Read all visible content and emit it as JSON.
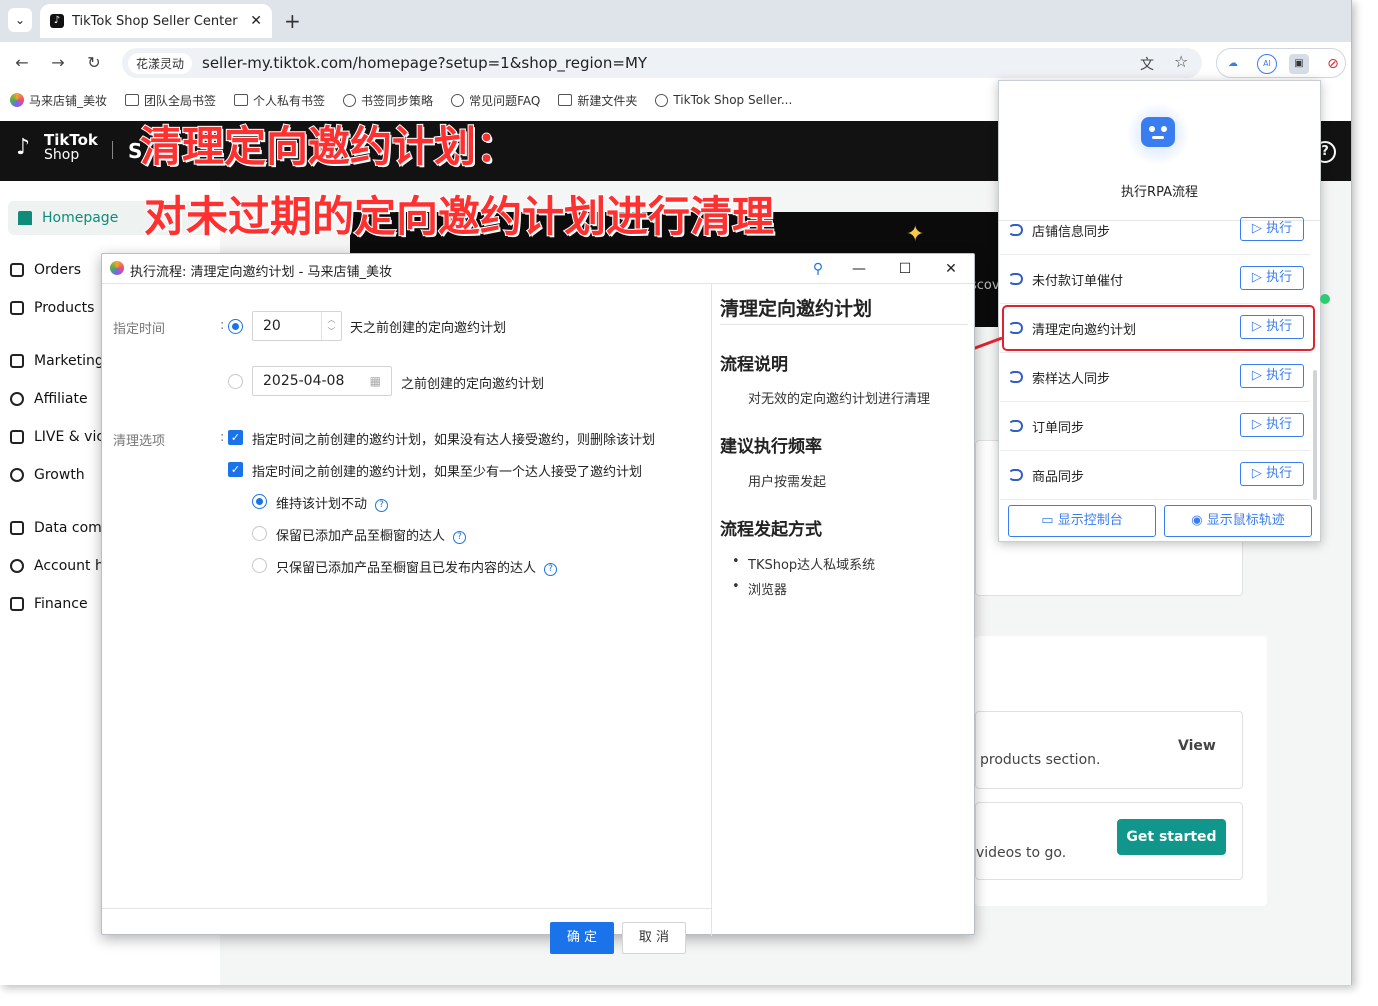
{
  "browser": {
    "tab_title": "TikTok Shop Seller Center | M",
    "site_chip": "花漾灵动",
    "url": "seller-my.tiktok.com/homepage?setup=1&shop_region=MY",
    "bookmarks": [
      "马来店铺_美妆",
      "团队全局书签",
      "个人私有书签",
      "书签同步策略",
      "常见问题FAQ",
      "新建文件夹",
      "TikTok Shop Seller..."
    ]
  },
  "tiktok": {
    "logo_top": "TikTok",
    "logo_bottom": "Shop",
    "header_text": "S",
    "sidebar": [
      "Homepage",
      "Orders",
      "Products",
      "Marketing",
      "Affiliate",
      "LIVE & vic",
      "Growth",
      "Data com",
      "Account h",
      "Finance"
    ],
    "banner_text": "scov",
    "card_view_text": "products section.",
    "card_view_link": "View",
    "card_get_text": "videos to go.",
    "get_started": "Get started"
  },
  "overlay": {
    "line1": "清理定向邀约计划：",
    "line2": "对未过期的定向邀约计划进行清理"
  },
  "rpa": {
    "title": "执行RPA流程",
    "rows": [
      {
        "label": "店铺信息同步",
        "button": "执行"
      },
      {
        "label": "未付款订单催付",
        "button": "执行"
      },
      {
        "label": "清理定向邀约计划",
        "button": "执行"
      },
      {
        "label": "索样达人同步",
        "button": "执行"
      },
      {
        "label": "订单同步",
        "button": "执行"
      },
      {
        "label": "商品同步",
        "button": "执行"
      }
    ],
    "footer_console": "显示控制台",
    "footer_mouse": "显示鼠标轨迹"
  },
  "dialog": {
    "title": "执行流程: 清理定向邀约计划 - 马来店铺_美妆",
    "time_label": "指定时间",
    "days_value": "20",
    "days_suffix": "天之前创建的定向邀约计划",
    "date_value": "2025-04-08",
    "date_suffix": "之前创建的定向邀约计划",
    "cleanup_label": "清理选项",
    "opt1": "指定时间之前创建的邀约计划，如果没有达人接受邀约，则删除该计划",
    "opt2": "指定时间之前创建的邀约计划，如果至少有一个达人接受了邀约计划",
    "sub1": "维持该计划不动",
    "sub2": "保留已添加产品至橱窗的达人",
    "sub3": "只保留已添加产品至橱窗且已发布内容的达人",
    "ok": "确 定",
    "cancel": "取 消",
    "doc_title": "清理定向邀约计划",
    "doc_h1": "流程说明",
    "doc_p1": "对无效的定向邀约计划进行清理",
    "doc_h2": "建议执行频率",
    "doc_p2": "用户按需发起",
    "doc_h3": "流程发起方式",
    "doc_li": [
      "TKShop达人私域系统",
      "浏览器"
    ]
  },
  "colors": {
    "accent": "#1a73e8",
    "teal": "#10968a",
    "highlight": "#e0242f",
    "overlay_text": "#ff3030"
  }
}
